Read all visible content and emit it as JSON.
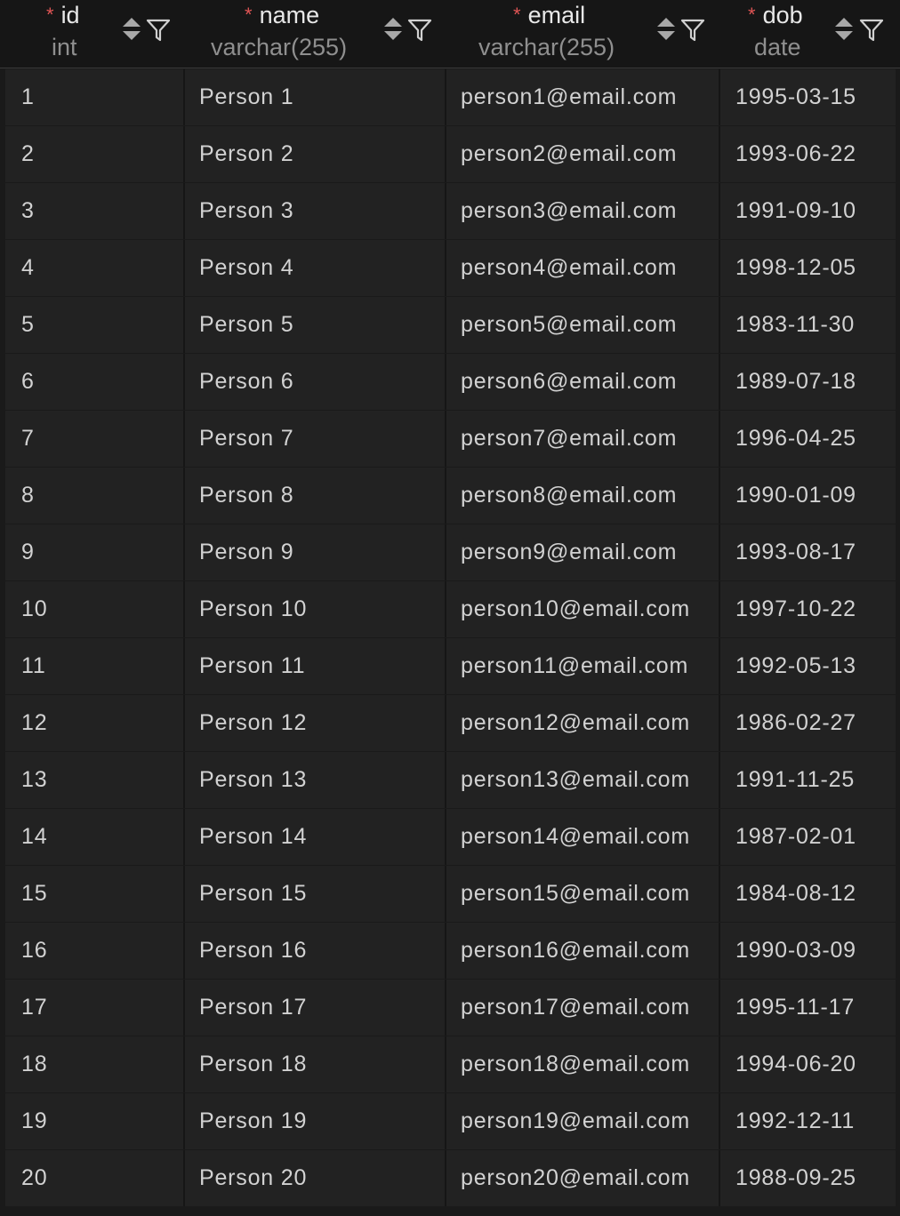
{
  "columns": [
    {
      "key": "id",
      "label": "id",
      "type": "int",
      "required": true,
      "required_mark": "*"
    },
    {
      "key": "name",
      "label": "name",
      "type": "varchar(255)",
      "required": true,
      "required_mark": "*"
    },
    {
      "key": "email",
      "label": "email",
      "type": "varchar(255)",
      "required": true,
      "required_mark": "*"
    },
    {
      "key": "dob",
      "label": "dob",
      "type": "date",
      "required": true,
      "required_mark": "*"
    }
  ],
  "icons": {
    "sort": "sort-up-down-icon",
    "filter": "filter-funnel-icon"
  },
  "colors": {
    "background": "#1a1a1a",
    "row": "#222222",
    "required": "#e05555",
    "text": "#d2d2d2",
    "type_text": "#8f8f8f"
  },
  "rows": [
    {
      "id": "1",
      "name": "Person 1",
      "email": "person1@email.com",
      "dob": "1995-03-15"
    },
    {
      "id": "2",
      "name": "Person 2",
      "email": "person2@email.com",
      "dob": "1993-06-22"
    },
    {
      "id": "3",
      "name": "Person 3",
      "email": "person3@email.com",
      "dob": "1991-09-10"
    },
    {
      "id": "4",
      "name": "Person 4",
      "email": "person4@email.com",
      "dob": "1998-12-05"
    },
    {
      "id": "5",
      "name": "Person 5",
      "email": "person5@email.com",
      "dob": "1983-11-30"
    },
    {
      "id": "6",
      "name": "Person 6",
      "email": "person6@email.com",
      "dob": "1989-07-18"
    },
    {
      "id": "7",
      "name": "Person 7",
      "email": "person7@email.com",
      "dob": "1996-04-25"
    },
    {
      "id": "8",
      "name": "Person 8",
      "email": "person8@email.com",
      "dob": "1990-01-09"
    },
    {
      "id": "9",
      "name": "Person 9",
      "email": "person9@email.com",
      "dob": "1993-08-17"
    },
    {
      "id": "10",
      "name": "Person 10",
      "email": "person10@email.com",
      "dob": "1997-10-22"
    },
    {
      "id": "11",
      "name": "Person 11",
      "email": "person11@email.com",
      "dob": "1992-05-13"
    },
    {
      "id": "12",
      "name": "Person 12",
      "email": "person12@email.com",
      "dob": "1986-02-27"
    },
    {
      "id": "13",
      "name": "Person 13",
      "email": "person13@email.com",
      "dob": "1991-11-25"
    },
    {
      "id": "14",
      "name": "Person 14",
      "email": "person14@email.com",
      "dob": "1987-02-01"
    },
    {
      "id": "15",
      "name": "Person 15",
      "email": "person15@email.com",
      "dob": "1984-08-12"
    },
    {
      "id": "16",
      "name": "Person 16",
      "email": "person16@email.com",
      "dob": "1990-03-09"
    },
    {
      "id": "17",
      "name": "Person 17",
      "email": "person17@email.com",
      "dob": "1995-11-17"
    },
    {
      "id": "18",
      "name": "Person 18",
      "email": "person18@email.com",
      "dob": "1994-06-20"
    },
    {
      "id": "19",
      "name": "Person 19",
      "email": "person19@email.com",
      "dob": "1992-12-11"
    },
    {
      "id": "20",
      "name": "Person 20",
      "email": "person20@email.com",
      "dob": "1988-09-25"
    }
  ]
}
